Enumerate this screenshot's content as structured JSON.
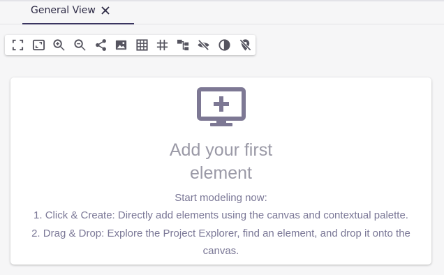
{
  "tabs": [
    {
      "label": "General View",
      "active": true,
      "close_icon": "close-icon"
    }
  ],
  "toolbar": {
    "tools": [
      {
        "name": "fit-screen-icon"
      },
      {
        "name": "fit-selection-icon"
      },
      {
        "name": "zoom-in-icon"
      },
      {
        "name": "zoom-out-icon"
      },
      {
        "name": "share-icon"
      },
      {
        "name": "image-export-icon"
      },
      {
        "name": "grid-icon"
      },
      {
        "name": "snap-grid-icon"
      },
      {
        "name": "tree-layout-icon"
      },
      {
        "name": "hide-icon"
      },
      {
        "name": "contrast-icon"
      },
      {
        "name": "pin-off-icon"
      }
    ]
  },
  "empty_state": {
    "icon": "add-screen-icon",
    "title_line1": "Add your first",
    "title_line2": "element",
    "subtitle": "Start modeling now:",
    "step1": "1. Click & Create: Directly add elements using the canvas and contextual palette.",
    "step2_line1": "2. Drag & Drop: Explore the Project Explorer, find an element, and drop it onto the",
    "step2_line2": "canvas."
  },
  "colors": {
    "accent": "#3a3560",
    "icon_purple": "#7d7894",
    "text_muted": "#7a7796",
    "title_gray": "#9a99a6"
  }
}
